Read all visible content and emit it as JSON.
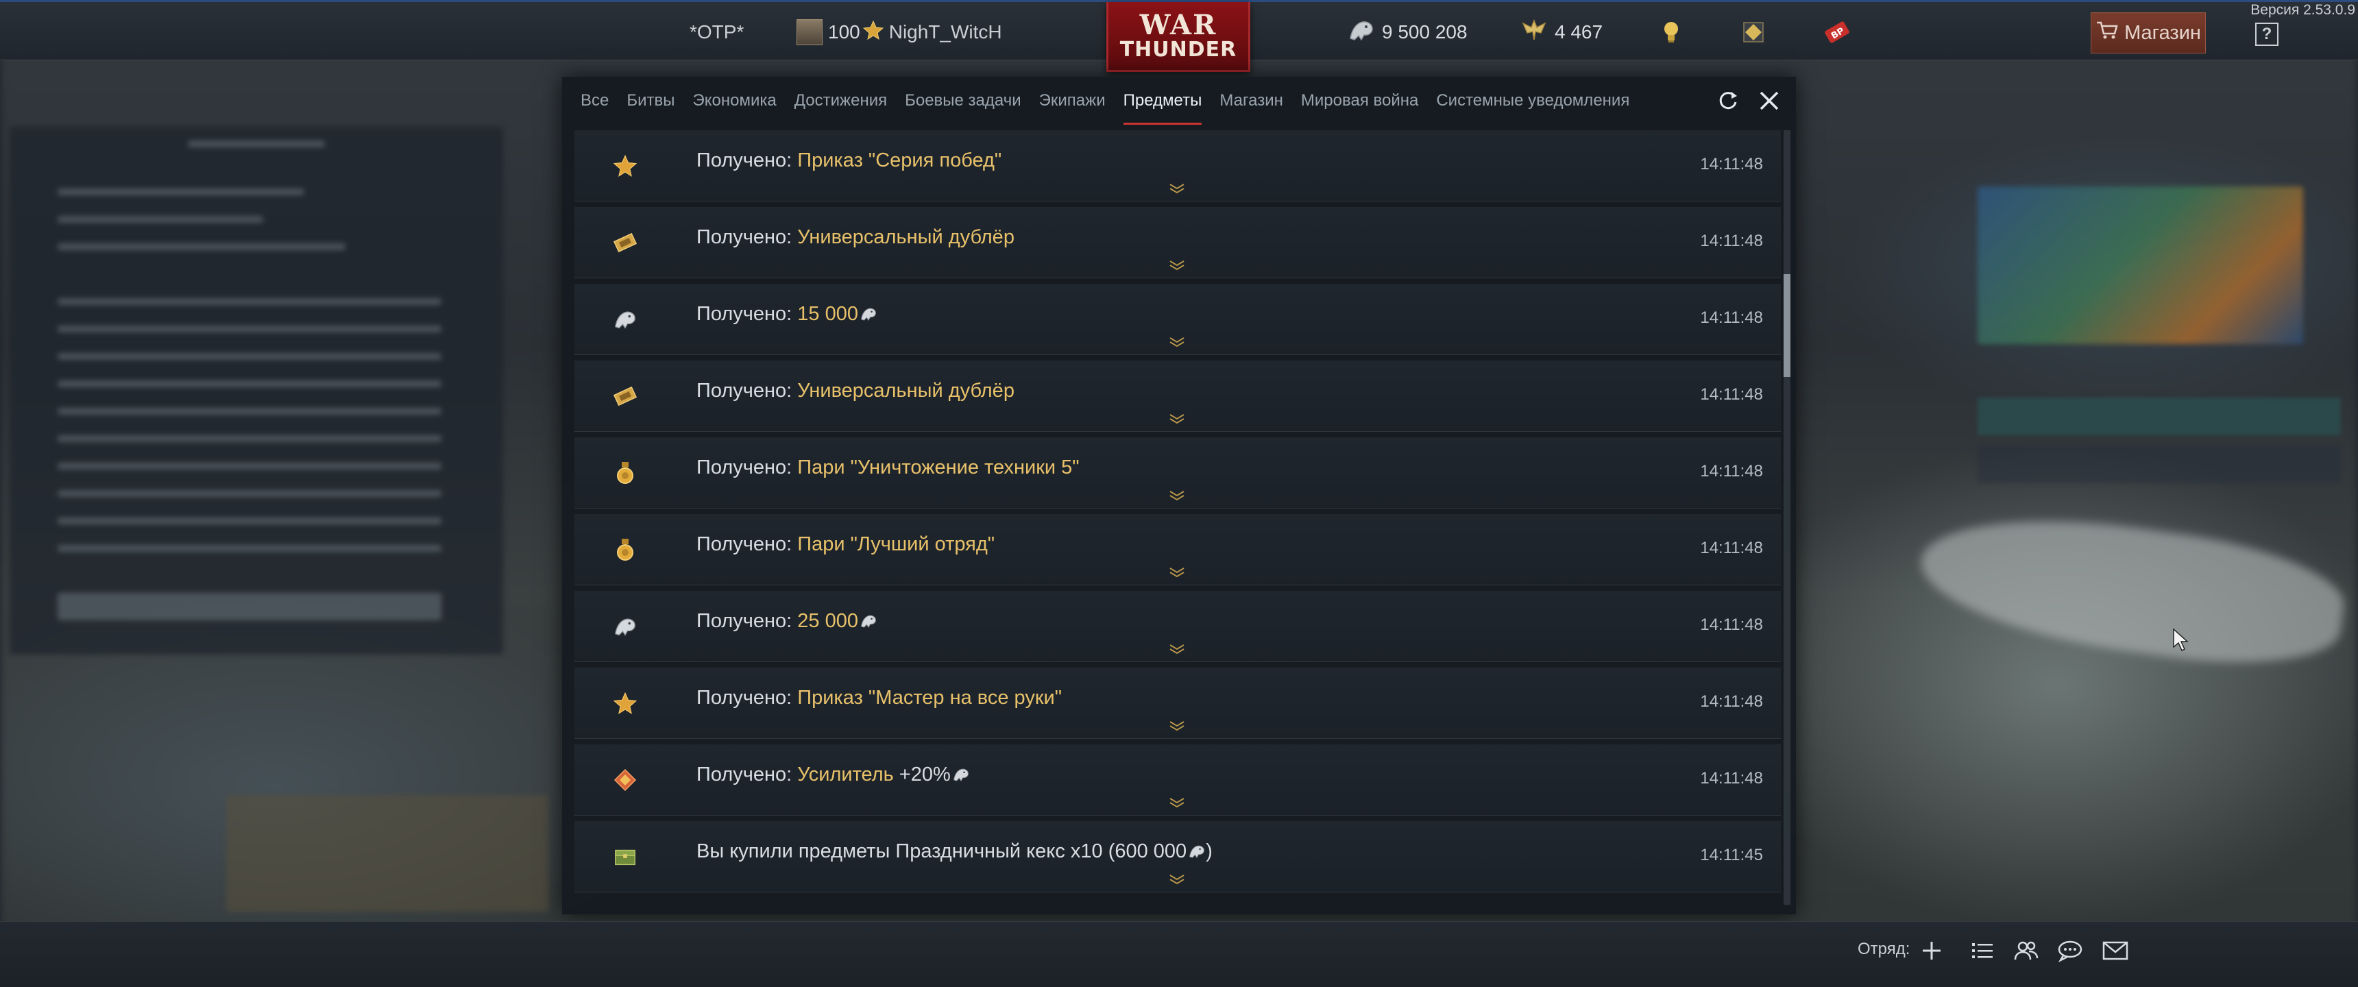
{
  "version": "Версия 2.53.0.9",
  "topbar": {
    "clan_tag": "*OTP*",
    "level": "100",
    "nickname": "NighT_WitcH",
    "silver_lions": "9 500 208",
    "golden_eagles": "4 467",
    "logo_line1": "WAR",
    "logo_line2": "THUNDER",
    "shop_label": "Магазин",
    "help_label": "?"
  },
  "tabs": [
    {
      "label": "Все"
    },
    {
      "label": "Битвы"
    },
    {
      "label": "Экономика"
    },
    {
      "label": "Достижения"
    },
    {
      "label": "Боевые задачи"
    },
    {
      "label": "Экипажи"
    },
    {
      "label": "Предметы",
      "active": true
    },
    {
      "label": "Магазин"
    },
    {
      "label": "Мировая война"
    },
    {
      "label": "Системные уведомления"
    }
  ],
  "notifications": [
    {
      "icon": "star-icon",
      "prefix": "Получено: ",
      "highlight": "Приказ \"Серия побед\"",
      "suffix": "",
      "time": "14:11:48"
    },
    {
      "icon": "ticket-icon",
      "prefix": "Получено: ",
      "highlight": "Универсальный дублёр",
      "suffix": "",
      "time": "14:11:48"
    },
    {
      "icon": "silver-lion-icon",
      "prefix": "Получено: ",
      "highlight": "15 000",
      "suffix": "",
      "time": "14:11:48",
      "lion": true
    },
    {
      "icon": "ticket-icon",
      "prefix": "Получено: ",
      "highlight": "Универсальный дублёр",
      "suffix": "",
      "time": "14:11:48"
    },
    {
      "icon": "wager-medal-icon",
      "prefix": "Получено: ",
      "highlight": "Пари \"Уничтожение техники 5\"",
      "suffix": "",
      "time": "14:11:48"
    },
    {
      "icon": "wager-medal-icon",
      "prefix": "Получено: ",
      "highlight": "Пари \"Лучший отряд\"",
      "suffix": "",
      "time": "14:11:48"
    },
    {
      "icon": "silver-lion-icon",
      "prefix": "Получено: ",
      "highlight": "25 000",
      "suffix": "",
      "time": "14:11:48",
      "lion": true
    },
    {
      "icon": "star-icon",
      "prefix": "Получено: ",
      "highlight": "Приказ \"Мастер на все руки\"",
      "suffix": "",
      "time": "14:11:48"
    },
    {
      "icon": "booster-icon",
      "prefix": "Получено: ",
      "highlight": "Усилитель",
      "suffix": " +20%",
      "time": "14:11:48",
      "lion_suffix": true
    },
    {
      "icon": "chest-icon",
      "prefix": "Вы купили предметы Праздничный кекс x10 (600 000",
      "highlight": "",
      "suffix": ")",
      "time": "14:11:45",
      "lion_mid": true
    }
  ],
  "bottombar": {
    "squad_label": "Отряд:"
  },
  "colors": {
    "accent_red": "#c8342f",
    "highlight_gold": "#e8c16a",
    "top_accent_blue": "#2b4c7e"
  }
}
